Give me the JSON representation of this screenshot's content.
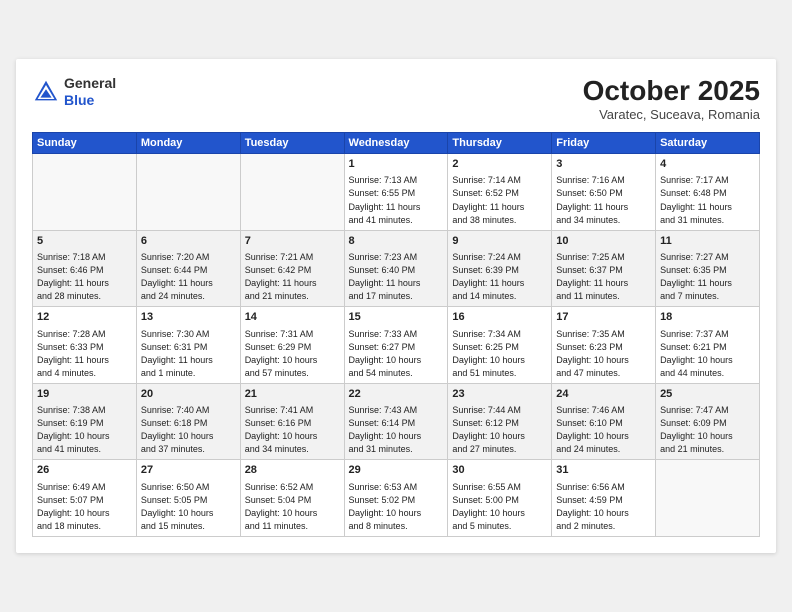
{
  "header": {
    "logo_general": "General",
    "logo_blue": "Blue",
    "month_title": "October 2025",
    "subtitle": "Varatec, Suceava, Romania"
  },
  "weekdays": [
    "Sunday",
    "Monday",
    "Tuesday",
    "Wednesday",
    "Thursday",
    "Friday",
    "Saturday"
  ],
  "weeks": [
    [
      {
        "day": "",
        "info": ""
      },
      {
        "day": "",
        "info": ""
      },
      {
        "day": "",
        "info": ""
      },
      {
        "day": "1",
        "info": "Sunrise: 7:13 AM\nSunset: 6:55 PM\nDaylight: 11 hours\nand 41 minutes."
      },
      {
        "day": "2",
        "info": "Sunrise: 7:14 AM\nSunset: 6:52 PM\nDaylight: 11 hours\nand 38 minutes."
      },
      {
        "day": "3",
        "info": "Sunrise: 7:16 AM\nSunset: 6:50 PM\nDaylight: 11 hours\nand 34 minutes."
      },
      {
        "day": "4",
        "info": "Sunrise: 7:17 AM\nSunset: 6:48 PM\nDaylight: 11 hours\nand 31 minutes."
      }
    ],
    [
      {
        "day": "5",
        "info": "Sunrise: 7:18 AM\nSunset: 6:46 PM\nDaylight: 11 hours\nand 28 minutes."
      },
      {
        "day": "6",
        "info": "Sunrise: 7:20 AM\nSunset: 6:44 PM\nDaylight: 11 hours\nand 24 minutes."
      },
      {
        "day": "7",
        "info": "Sunrise: 7:21 AM\nSunset: 6:42 PM\nDaylight: 11 hours\nand 21 minutes."
      },
      {
        "day": "8",
        "info": "Sunrise: 7:23 AM\nSunset: 6:40 PM\nDaylight: 11 hours\nand 17 minutes."
      },
      {
        "day": "9",
        "info": "Sunrise: 7:24 AM\nSunset: 6:39 PM\nDaylight: 11 hours\nand 14 minutes."
      },
      {
        "day": "10",
        "info": "Sunrise: 7:25 AM\nSunset: 6:37 PM\nDaylight: 11 hours\nand 11 minutes."
      },
      {
        "day": "11",
        "info": "Sunrise: 7:27 AM\nSunset: 6:35 PM\nDaylight: 11 hours\nand 7 minutes."
      }
    ],
    [
      {
        "day": "12",
        "info": "Sunrise: 7:28 AM\nSunset: 6:33 PM\nDaylight: 11 hours\nand 4 minutes."
      },
      {
        "day": "13",
        "info": "Sunrise: 7:30 AM\nSunset: 6:31 PM\nDaylight: 11 hours\nand 1 minute."
      },
      {
        "day": "14",
        "info": "Sunrise: 7:31 AM\nSunset: 6:29 PM\nDaylight: 10 hours\nand 57 minutes."
      },
      {
        "day": "15",
        "info": "Sunrise: 7:33 AM\nSunset: 6:27 PM\nDaylight: 10 hours\nand 54 minutes."
      },
      {
        "day": "16",
        "info": "Sunrise: 7:34 AM\nSunset: 6:25 PM\nDaylight: 10 hours\nand 51 minutes."
      },
      {
        "day": "17",
        "info": "Sunrise: 7:35 AM\nSunset: 6:23 PM\nDaylight: 10 hours\nand 47 minutes."
      },
      {
        "day": "18",
        "info": "Sunrise: 7:37 AM\nSunset: 6:21 PM\nDaylight: 10 hours\nand 44 minutes."
      }
    ],
    [
      {
        "day": "19",
        "info": "Sunrise: 7:38 AM\nSunset: 6:19 PM\nDaylight: 10 hours\nand 41 minutes."
      },
      {
        "day": "20",
        "info": "Sunrise: 7:40 AM\nSunset: 6:18 PM\nDaylight: 10 hours\nand 37 minutes."
      },
      {
        "day": "21",
        "info": "Sunrise: 7:41 AM\nSunset: 6:16 PM\nDaylight: 10 hours\nand 34 minutes."
      },
      {
        "day": "22",
        "info": "Sunrise: 7:43 AM\nSunset: 6:14 PM\nDaylight: 10 hours\nand 31 minutes."
      },
      {
        "day": "23",
        "info": "Sunrise: 7:44 AM\nSunset: 6:12 PM\nDaylight: 10 hours\nand 27 minutes."
      },
      {
        "day": "24",
        "info": "Sunrise: 7:46 AM\nSunset: 6:10 PM\nDaylight: 10 hours\nand 24 minutes."
      },
      {
        "day": "25",
        "info": "Sunrise: 7:47 AM\nSunset: 6:09 PM\nDaylight: 10 hours\nand 21 minutes."
      }
    ],
    [
      {
        "day": "26",
        "info": "Sunrise: 6:49 AM\nSunset: 5:07 PM\nDaylight: 10 hours\nand 18 minutes."
      },
      {
        "day": "27",
        "info": "Sunrise: 6:50 AM\nSunset: 5:05 PM\nDaylight: 10 hours\nand 15 minutes."
      },
      {
        "day": "28",
        "info": "Sunrise: 6:52 AM\nSunset: 5:04 PM\nDaylight: 10 hours\nand 11 minutes."
      },
      {
        "day": "29",
        "info": "Sunrise: 6:53 AM\nSunset: 5:02 PM\nDaylight: 10 hours\nand 8 minutes."
      },
      {
        "day": "30",
        "info": "Sunrise: 6:55 AM\nSunset: 5:00 PM\nDaylight: 10 hours\nand 5 minutes."
      },
      {
        "day": "31",
        "info": "Sunrise: 6:56 AM\nSunset: 4:59 PM\nDaylight: 10 hours\nand 2 minutes."
      },
      {
        "day": "",
        "info": ""
      }
    ]
  ]
}
